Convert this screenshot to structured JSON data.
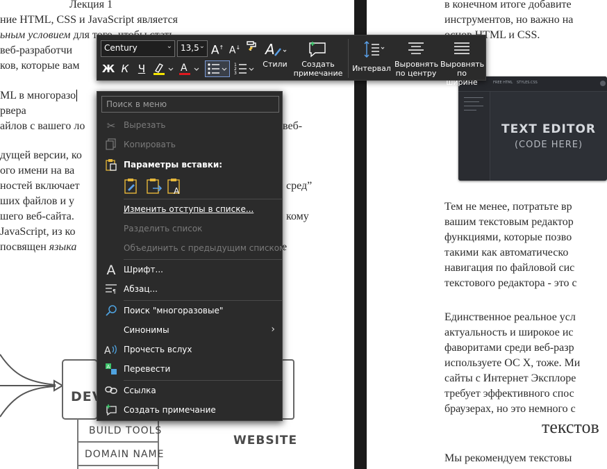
{
  "document": {
    "left_lines": [
      {
        "text": "Лекция 1"
      },
      {
        "text": "ние HTML, CSS и JavaScript является"
      },
      {
        "pre": "",
        "em": "ьным условием",
        "post": " для того, чтобы стать"
      },
      {
        "text": " веб-разработчи"
      },
      {
        "text": "ков, которые вам"
      },
      {
        "text": "ML в многоразо"
      },
      {
        "text": "рвера"
      },
      {
        "text": "айлов с вашего ло"
      },
      {
        "text": "дущей версии, ко"
      },
      {
        "text": "ого имени на ва"
      },
      {
        "text": "ностей включает"
      },
      {
        "text": "ших файлов и у"
      },
      {
        "text": "шего веб-сайта."
      },
      {
        "text": "JavaScript, из ко"
      },
      {
        "pre": " посвящен ",
        "em": "языка",
        "post": ""
      }
    ],
    "left_tail_fragments": {
      "a": "веб-",
      "b": "сред”",
      "c": "кому",
      "d": "е"
    },
    "diagram": {
      "dev_label": "DEV",
      "build_tools": "BUILD TOOLS",
      "domain_name": "DOMAIN NAME",
      "website": "WEBSITE"
    },
    "right_lines_top": [
      "в конечном итоге добавите",
      "инструментов, но важно на",
      "основ HTML и CSS."
    ],
    "editor_image": {
      "title": "TEXT EDITOR",
      "subtitle": "(CODE HERE)",
      "tab1": "FREE HTML",
      "tab2": "STYLES.CSS"
    },
    "right_para1": [
      "Тем не менее, потратьте вр",
      "вашим текстовым редактор",
      "функциями, которые позво",
      "такими как автоматическо",
      "навигация по файловой сис",
      "текстового редактора - это с"
    ],
    "right_para2": [
      "Единственное реальное усл",
      "актуальность и широкое ис",
      "фаворитами среди веб-разр",
      "используете ОС X, тоже. Ми",
      "сайты с Интернет Эксплоре",
      "требует эффективного спос",
      "браузерах, но это немного с"
    ],
    "right_heading": "текстов",
    "right_last": "Мы рекомендуем текстовы"
  },
  "toolbar": {
    "font_name": "Century",
    "font_size": "13,5",
    "grow_font": "A",
    "shrink_font": "A",
    "bold": "Ж",
    "italic": "К",
    "underline": "Ч",
    "styles_label": "Стили",
    "comment_label_1": "Создать",
    "comment_label_2": "примечание",
    "spacing_label": "Интервал",
    "center_label_1": "Выровнять",
    "center_label_2": "по центру",
    "justify_label_1": "Выровнять",
    "justify_label_2": "по ширине",
    "highlight_color": "#f4e400",
    "font_color": "#e0191f"
  },
  "context_menu": {
    "search_placeholder": "Поиск в меню",
    "cut": "Вырезать",
    "copy": "Копировать",
    "paste_options": "Параметры вставки:",
    "change_list_indents": "Изменить отступы в списке...",
    "split_list": "Разделить список",
    "join_previous_list": "Объединить с предыдущим списком",
    "font": "Шрифт...",
    "paragraph": "Абзац...",
    "search_word": "Поиск \"многоразовые\"",
    "synonyms": "Синонимы",
    "read_aloud": "Прочесть вслух",
    "translate": "Перевести",
    "link": "Ссылка",
    "new_comment": "Создать примечание"
  },
  "colors": {
    "menu_bg": "#2b2b2b",
    "accent": "#4fa3e0",
    "disabled": "#7a7a7a"
  }
}
